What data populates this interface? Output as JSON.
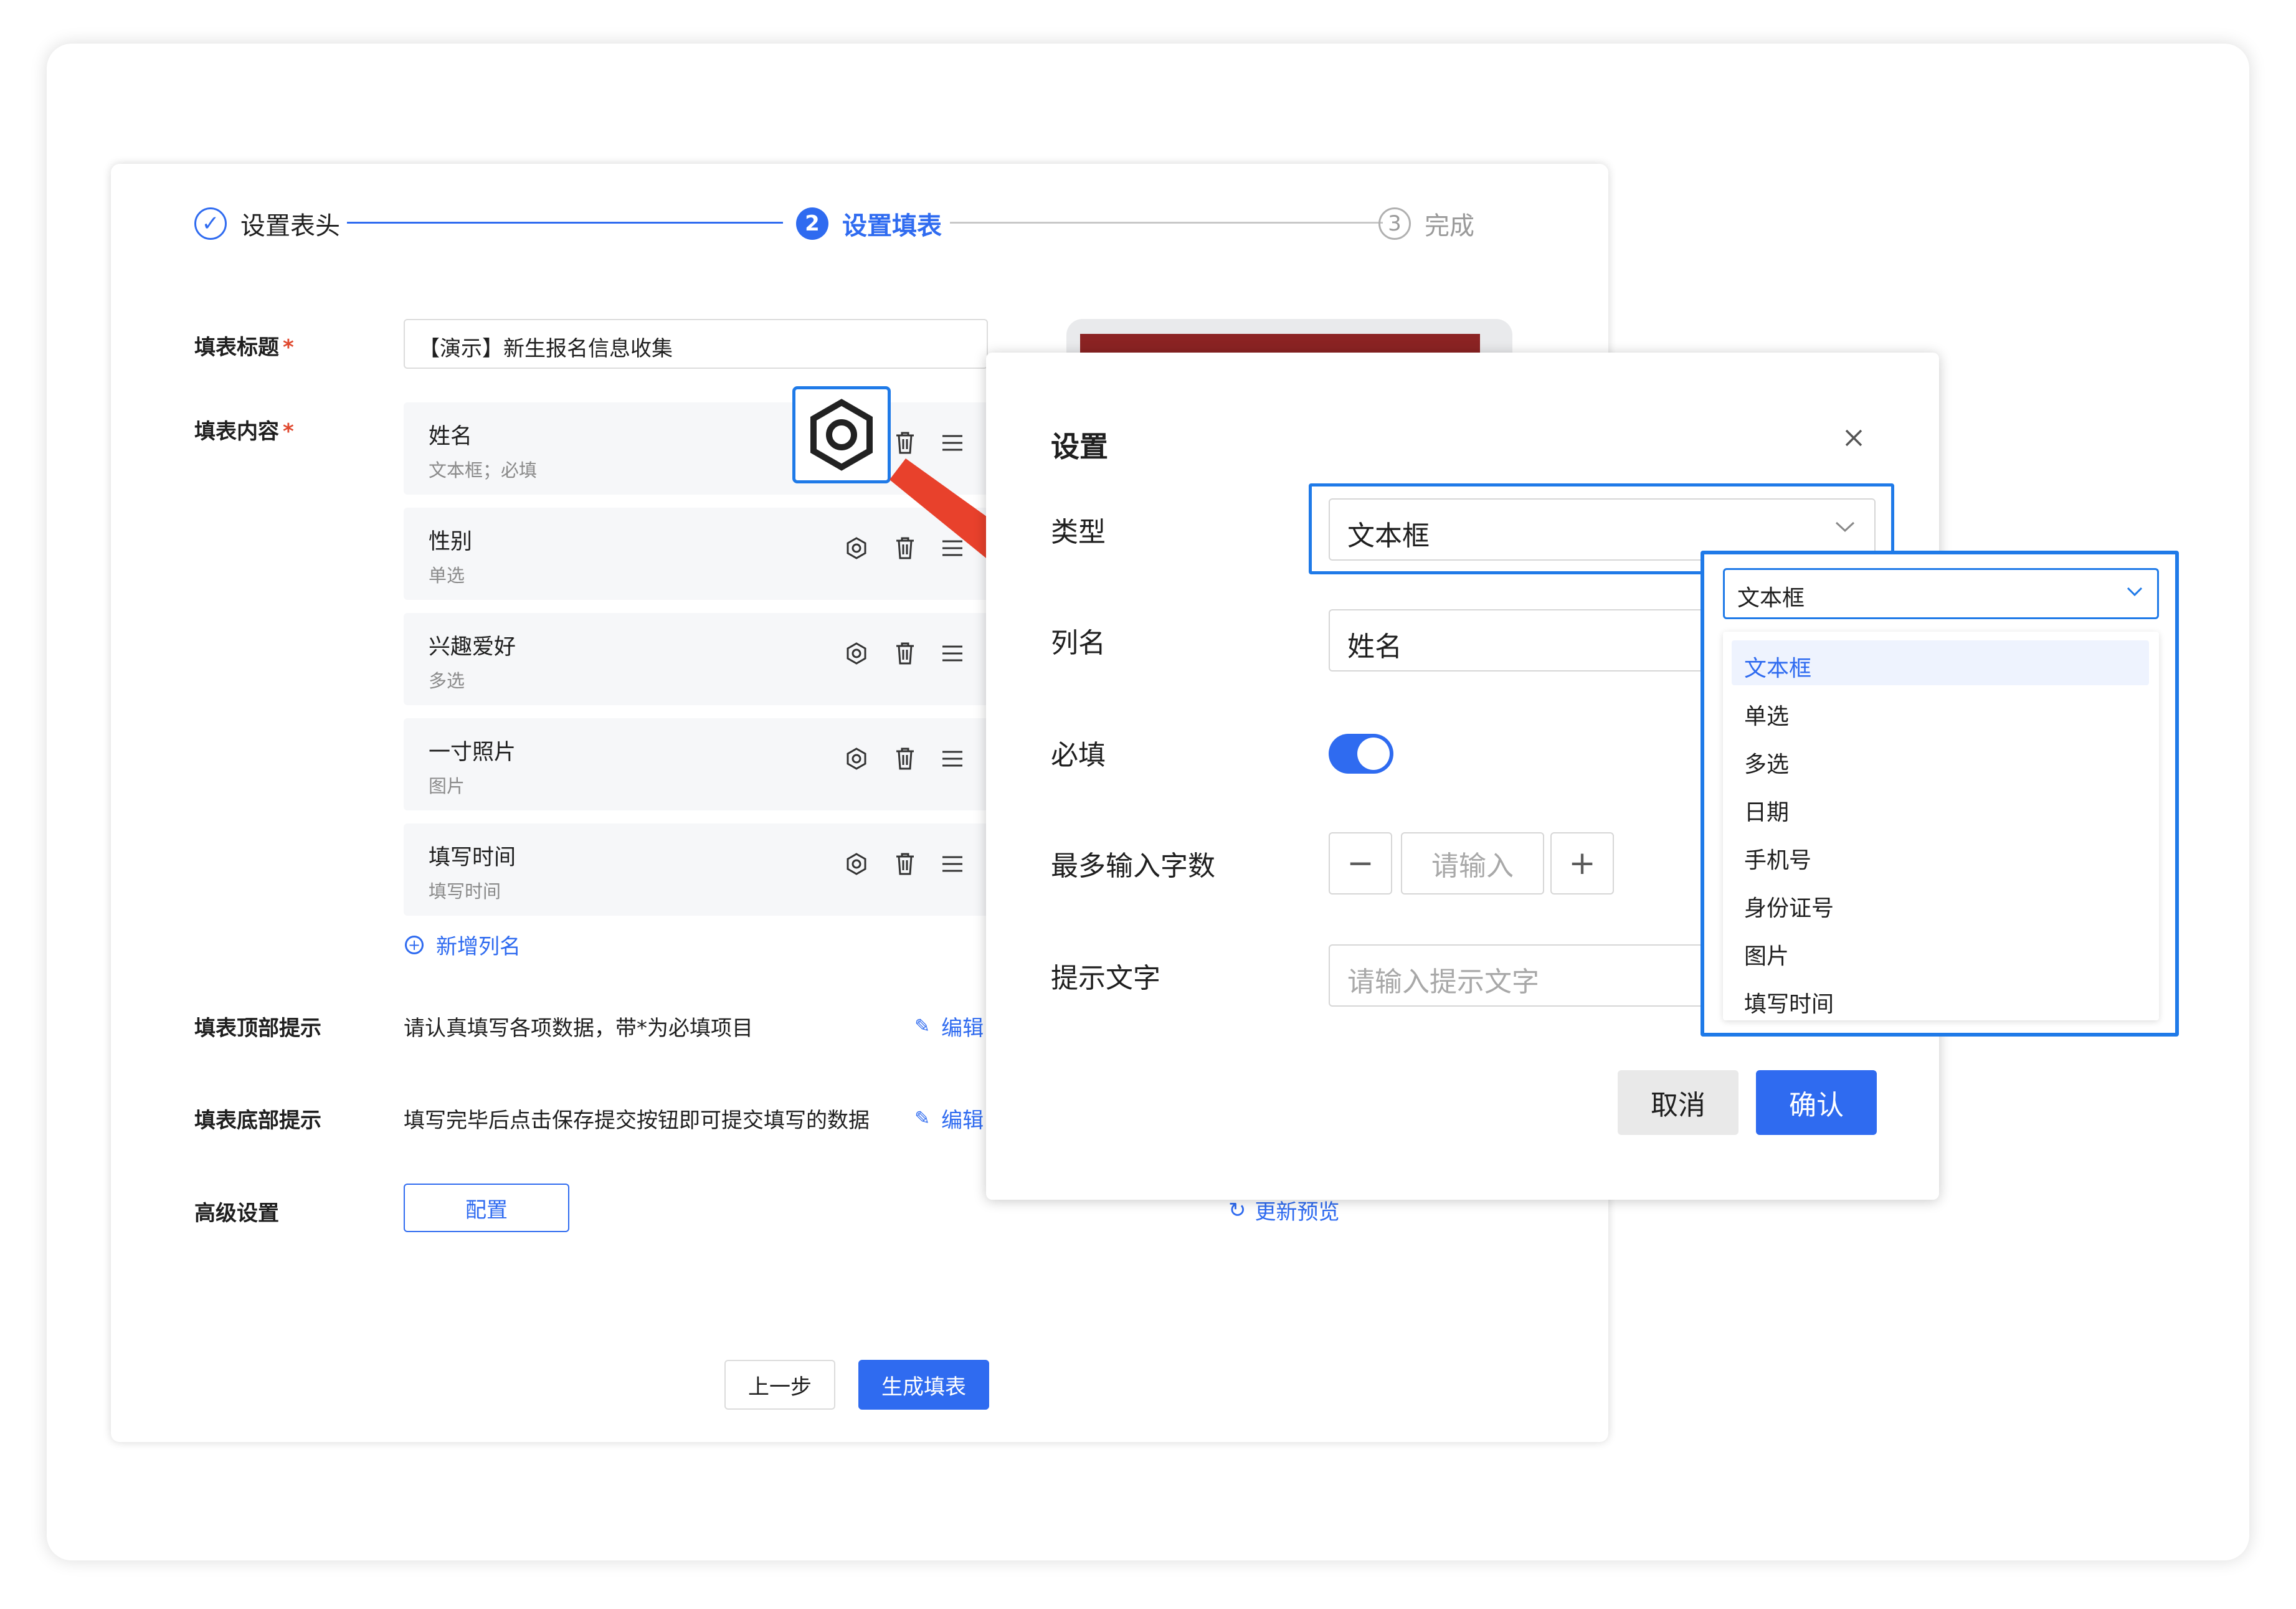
{
  "steps": [
    {
      "label": "设置表头",
      "marker": "✓",
      "state": "done"
    },
    {
      "label": "设置填表",
      "marker": "2",
      "state": "active"
    },
    {
      "label": "完成",
      "marker": "3",
      "state": "pending"
    }
  ],
  "form": {
    "title_label": "填表标题",
    "content_label": "填表内容",
    "required_mark": "*",
    "title_value": "【演示】新生报名信息收集",
    "fields": [
      {
        "name": "姓名",
        "sub": "文本框；必填"
      },
      {
        "name": "性别",
        "sub": "单选"
      },
      {
        "name": "兴趣爱好",
        "sub": "多选"
      },
      {
        "name": "一寸照片",
        "sub": "图片"
      },
      {
        "name": "填写时间",
        "sub": "填写时间"
      }
    ],
    "add_column": "新增列名",
    "top_tip_label": "填表顶部提示",
    "top_tip_text": "请认真填写各项数据，带*为必填项目",
    "bottom_tip_label": "填表底部提示",
    "bottom_tip_text": "填写完毕后点击保存提交按钮即可提交填写的数据",
    "edit_link": "编辑",
    "advanced_label": "高级设置",
    "config_button": "配置",
    "refresh_link": "更新预览",
    "prev_button": "上一步",
    "generate_button": "生成填表"
  },
  "modal": {
    "title": "设置",
    "type_label": "类型",
    "type_value": "文本框",
    "name_label": "列名",
    "name_value": "姓名",
    "required_label": "必填",
    "required_on": true,
    "maxlen_label": "最多输入字数",
    "maxlen_placeholder": "请输入",
    "minus": "−",
    "plus": "+",
    "hint_label": "提示文字",
    "hint_placeholder": "请输入提示文字",
    "cancel_button": "取消",
    "ok_button": "确认"
  },
  "dropdown": {
    "selected": "文本框",
    "options": [
      "文本框",
      "单选",
      "多选",
      "日期",
      "手机号",
      "身份证号",
      "图片",
      "填写时间"
    ]
  },
  "colors": {
    "accent": "#2f6bf0",
    "highlight": "#1f7ae8",
    "arrow": "#e8412c",
    "required": "#e0492f",
    "preview_bar": "#8b2323"
  },
  "icons": {
    "gear": "gear-icon",
    "trash": "trash-icon",
    "menu": "drag-handle-icon",
    "close": "close-icon",
    "chevron": "chevron-down-icon",
    "edit": "pencil-icon",
    "refresh": "refresh-icon",
    "add": "plus-circle-icon"
  }
}
